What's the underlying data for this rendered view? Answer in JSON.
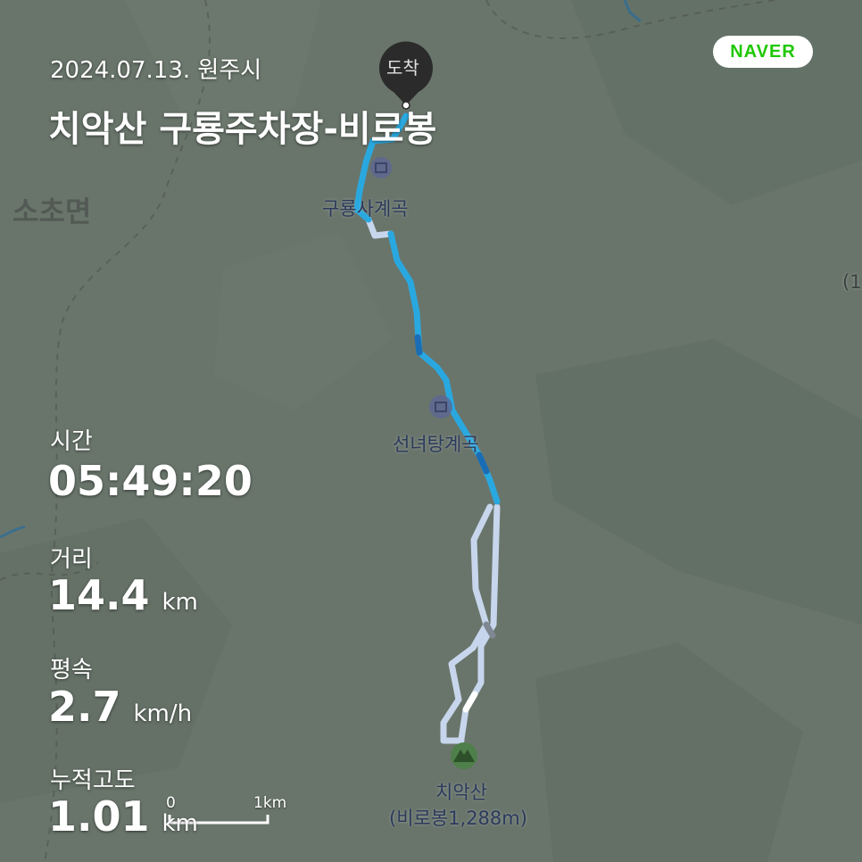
{
  "header": {
    "date_city": "2024.07.13. 원주시",
    "route_title": "치악산 구룡주차장-비로봉"
  },
  "stats": {
    "time_label": "시간",
    "time_value": "05:49:20",
    "distance_label": "거리",
    "distance_value": "14.4",
    "distance_unit": "km",
    "speed_label": "평속",
    "speed_value": "2.7",
    "speed_unit": "km/h",
    "elevation_label": "누적고도",
    "elevation_value": "1.01",
    "elevation_unit": "km"
  },
  "map": {
    "brand": "NAVER",
    "region_label": "소초면",
    "edge_label": "(1",
    "arrival_marker": "도착",
    "places": {
      "guryong_valley": "구룡사계곡",
      "seonnyeotang_valley": "선녀탕계곡",
      "summit_name": "치악산",
      "summit_detail": "(비로봉1,288m)"
    },
    "scale": {
      "zero": "0",
      "max": "1km"
    },
    "colors": {
      "route_active": "#29a8e0",
      "route_dark": "#1a6db5",
      "route_inactive": "#c7d6ec",
      "marker": "#2b2b2b",
      "brand": "#1ec800"
    }
  }
}
